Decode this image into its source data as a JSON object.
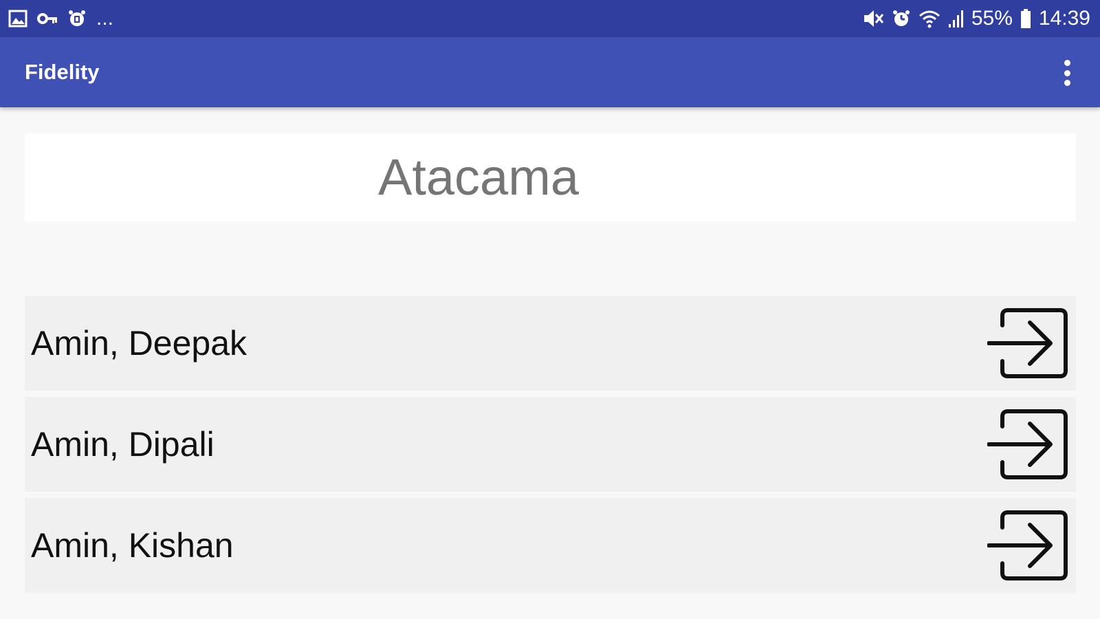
{
  "status_bar": {
    "battery": "55%",
    "time": "14:39",
    "more": "...",
    "icons_left": [
      "image-icon",
      "key-icon",
      "alarm-clock-icon"
    ],
    "icons_right": [
      "mute-icon",
      "alarm-icon",
      "wifi-icon",
      "signal-icon",
      "battery-icon"
    ]
  },
  "app_bar": {
    "title": "Fidelity",
    "menu_icon": "more-vert-icon",
    "background": "#3f51b5",
    "status_background": "#303f9f"
  },
  "location": {
    "title": "Atacama"
  },
  "people": [
    {
      "name": "Amin, Deepak",
      "action_icon": "sign-in-icon"
    },
    {
      "name": "Amin, Dipali",
      "action_icon": "sign-in-icon"
    },
    {
      "name": "Amin, Kishan",
      "action_icon": "sign-in-icon"
    }
  ]
}
